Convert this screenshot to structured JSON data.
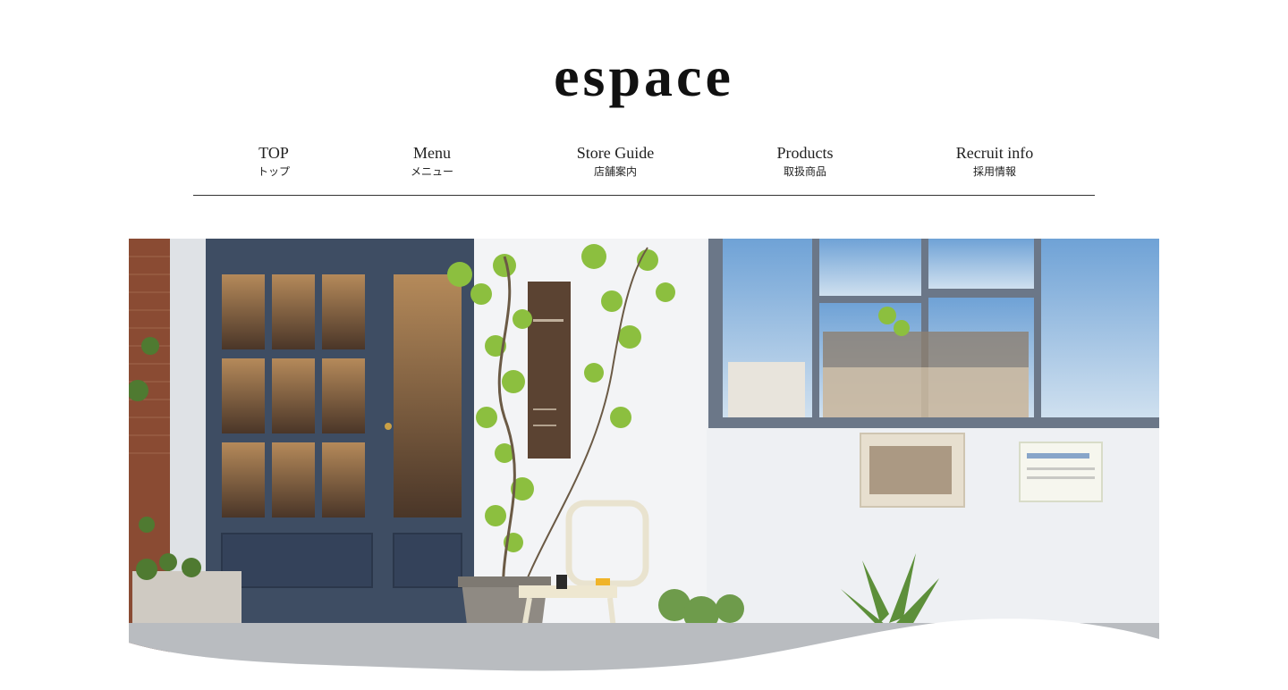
{
  "site": {
    "title": "espace"
  },
  "nav": {
    "items": [
      {
        "en": "TOP",
        "ja": "トップ"
      },
      {
        "en": "Menu",
        "ja": "メニュー"
      },
      {
        "en": "Store Guide",
        "ja": "店舗案内"
      },
      {
        "en": "Products",
        "ja": "取扱商品"
      },
      {
        "en": "Recruit info",
        "ja": "採用情報"
      }
    ]
  },
  "hero": {
    "subject": "storefront-photo",
    "colors": {
      "wall": "#eef0f3",
      "door_frame": "#3e4d63",
      "brick": "#8a4b33",
      "leaf": "#8cbf3f",
      "ground": "#b9bcc0"
    }
  }
}
